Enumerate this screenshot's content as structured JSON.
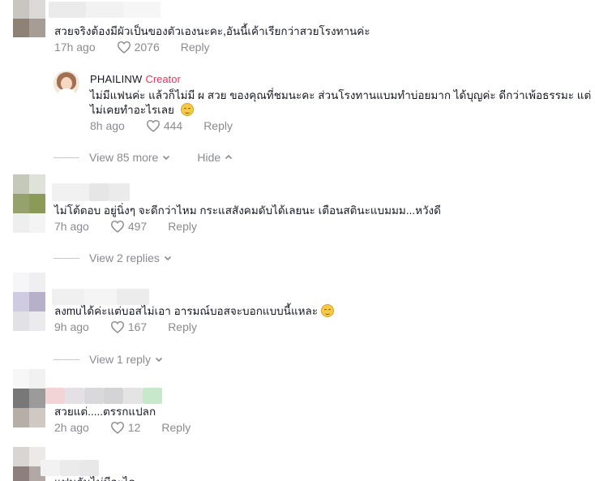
{
  "comments": [
    {
      "text": "สวยจริงต้องมีผัวเป็นของตัวเองนะคะ,อันนี้เค้าเรียกว่าสวยโรงทานค่ะ",
      "time": "17h ago",
      "likes": "2076",
      "reply_label": "Reply"
    },
    {
      "text": "ไม่โต้ตอบ อยู่นิ่งๆ จะดีกว่าไหม กระแสสังคมดับได้เลยนะ เตือนสตินะแบมมม...หวังดี",
      "time": "7h ago",
      "likes": "497",
      "reply_label": "Reply"
    },
    {
      "text": "ลงmuได้ค่ะแต่บอสไม่เอา อารมณ์บอสจะบอกแบบนี้แหละ",
      "time": "9h ago",
      "likes": "167",
      "reply_label": "Reply"
    },
    {
      "text": "สวยแต่.....ตรรกแปลก",
      "time": "2h ago",
      "likes": "12",
      "reply_label": "Reply"
    }
  ],
  "creator_reply": {
    "username": "PHAILINW",
    "tag": "Creator",
    "line1": "ไม่มีแฟนค่ะ แล้วก็ไม่มี ผ สวย ของคุณที่ชมนะคะ ส่วนโรงทานแบมทำบ่อยมาก ได้บุญค่ะ ดีกว่าเพ้อธรรมะ แต่",
    "line2": "ไม่เคยทำอะไรเลย",
    "time": "8h ago",
    "likes": "444",
    "reply_label": "Reply"
  },
  "thread_controls": {
    "view_more": "View 85 more",
    "hide": "Hide",
    "view_2": "View 2 replies",
    "view_1": "View 1 reply"
  },
  "partial_last_text": "แฟนกันไม่มีอะไร",
  "colors": {
    "text": "#161823",
    "muted": "#8a8b91",
    "creator_accent": "#fe2c55"
  }
}
